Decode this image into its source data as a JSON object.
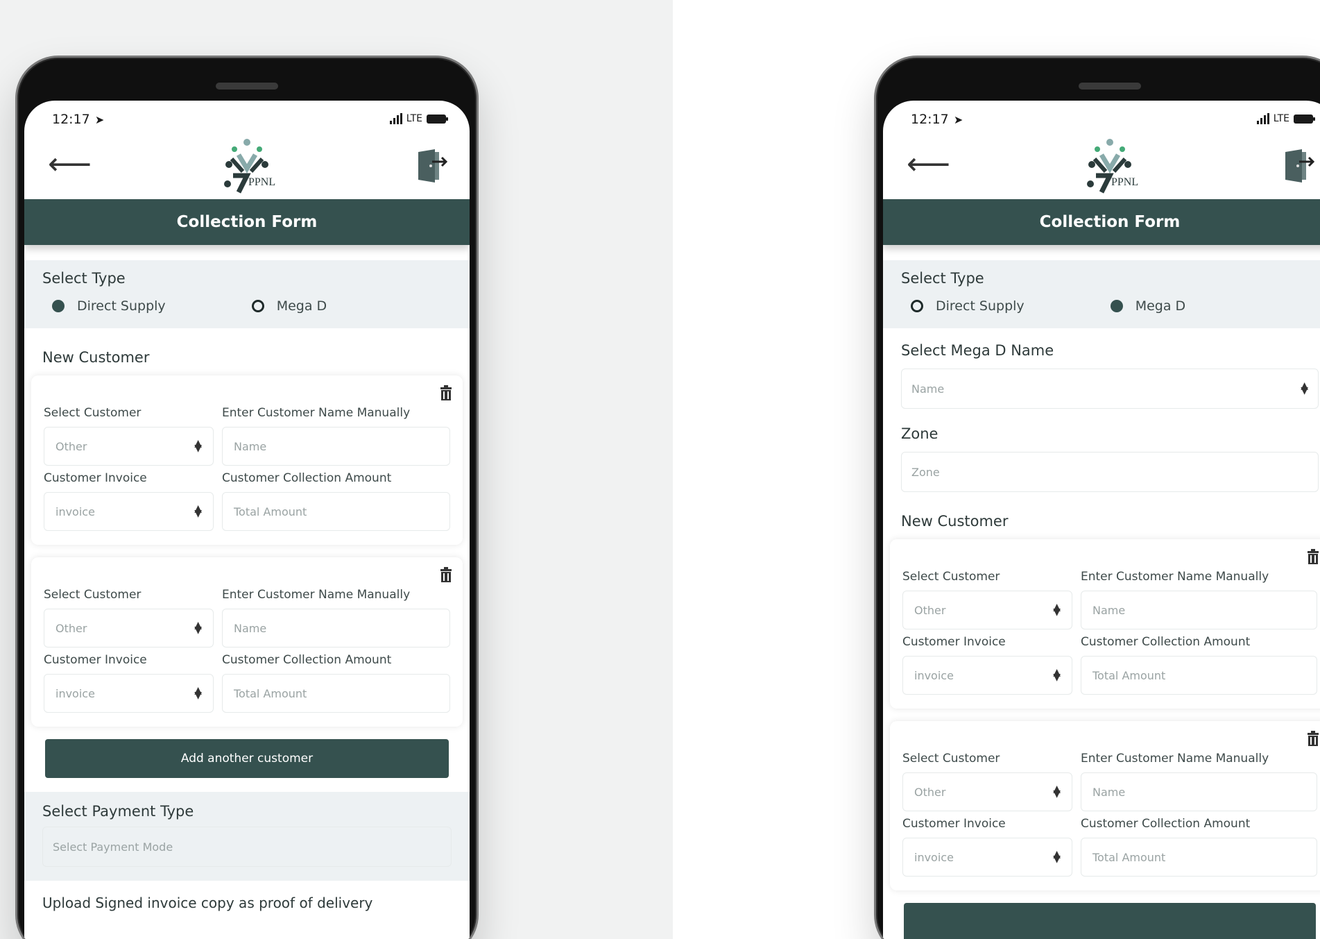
{
  "status": {
    "time": "12:17",
    "network": "LTE"
  },
  "header": {
    "title": "Collection Form",
    "logo_text": "PPNL"
  },
  "select_type": {
    "label": "Select Type",
    "options": [
      "Direct Supply",
      "Mega D"
    ]
  },
  "new_customer_label": "New Customer",
  "customer_card": {
    "select_customer_label": "Select Customer",
    "select_customer_value": "Other",
    "manual_name_label": "Enter Customer Name Manually",
    "manual_name_placeholder": "Name",
    "invoice_label": "Customer Invoice",
    "invoice_value": "invoice",
    "amount_label": "Customer Collection Amount",
    "amount_placeholder": "Total Amount"
  },
  "add_customer_button": "Add another customer",
  "payment": {
    "label": "Select Payment Type",
    "placeholder": "Select Payment Mode"
  },
  "upload_label": "Upload Signed invoice copy as proof of delivery",
  "mega_d": {
    "name_label": "Select Mega D Name",
    "name_placeholder": "Name",
    "zone_label": "Zone",
    "zone_placeholder": "Zone"
  },
  "colors": {
    "primary": "#35514f",
    "section_bg": "#edf1f3"
  }
}
